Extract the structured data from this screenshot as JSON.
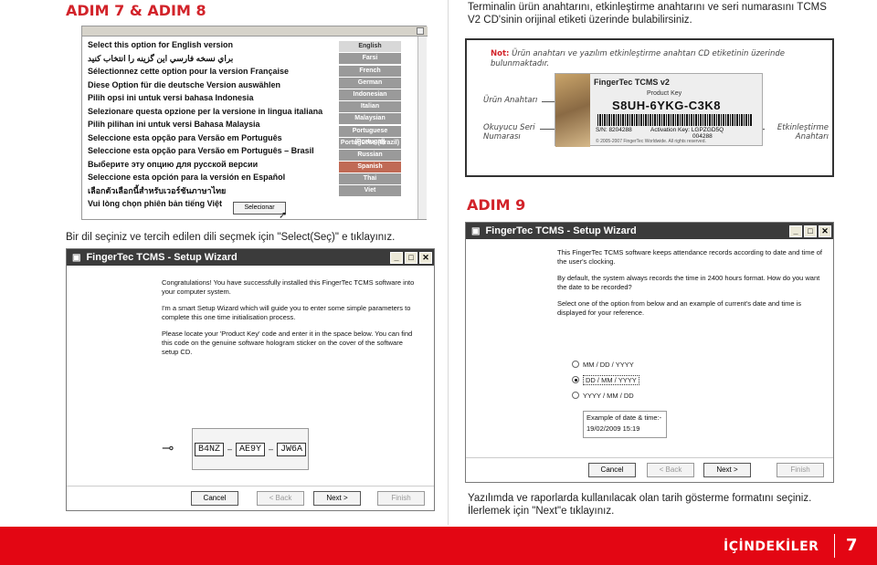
{
  "steps": {
    "left_title": "ADIM 7 & ADIM 8",
    "right_title": "ADIM 9"
  },
  "intro_text": "Terminalin ürün anahtarını, etkinleştirme anahtarını ve seri numarasını TCMS V2 CD'sinin orijinal etiketi üzerinde bulabilirsiniz.",
  "note": {
    "label": "Not:",
    "text": "Ürün anahtarı ve yazılım etkinleştirme anahtarı CD etiketinin üzerinde bulunmaktadır.",
    "callouts": {
      "product_key": "Ürün Anahtarı",
      "serial": "Okuyucu Seri Numarası",
      "activation": "Etkinleştirme Anahtarı"
    },
    "sticker": {
      "brand": "FingerTec TCMS v2",
      "pk_label": "Product Key",
      "pk_value": "S8UH-6YKG-C3K8",
      "sn": "S/N: 8204288",
      "activation": "Activation Key: LGPZGD5Q",
      "small": "004288",
      "copyright": "© 2005-2007 FingerTec Worldwide. All rights reserved."
    }
  },
  "language_window": {
    "rows": [
      "Select this option for English version",
      "براي نسخه فارسي اين گزينه را انتخاب كنيد",
      "Sélectionnez cette option pour la version Française",
      "Diese Option für die deutsche Version auswählen",
      "Pilih opsi ini untuk versi bahasa Indonesia",
      "Selezionare questa opzione per la versione in lingua italiana",
      "Pilih pilihan ini untuk versi Bahasa Malaysia",
      "Seleccione esta opção para Versão em Português",
      "Seleccione esta opção para Versão em Português – Brasil",
      "Выберите эту опцию для русской версии",
      "Seleccione esta opción para la versión en Español",
      "เลือกตัวเลือกนี้สำหรับเวอร์ชันภาษาไทย",
      "Vui lòng chọn phiên bản tiếng Việt"
    ],
    "buttons": [
      "English",
      "Farsi",
      "French",
      "German",
      "Indonesian",
      "Italian",
      "Malaysian",
      "Portuguese (Portugal)",
      "Portuguese (Brazil)",
      "Russian",
      "Spanish",
      "Thai",
      "Viet"
    ],
    "select_label": "Selecionar"
  },
  "left_caption": "Bir dil seçiniz ve tercih edilen dili seçmek için \"Select(Seç)\" e tıklayınız.",
  "wizard1": {
    "title": "FingerTec TCMS - Setup Wizard",
    "p1": "Congratulations! You have successfully installed this FingerTec TCMS software into your computer system.",
    "p2": "I'm a smart Setup Wizard which will guide you to enter some simple parameters to complete this one time initialisation process.",
    "p3": "Please locate your 'Product Key' code and enter it in the space below. You can find this code on the genuine software hologram sticker on the cover of the software setup CD.",
    "keys": [
      "B4NZ",
      "AE9Y",
      "JW6A"
    ],
    "cancel": "Cancel",
    "back": "< Back",
    "next": "Next >",
    "finish": "Finish"
  },
  "wizard2": {
    "title": "FingerTec TCMS - Setup Wizard",
    "p1": "This FingerTec TCMS software keeps attendance records according to date and time of the user's clocking.",
    "p2": "By default, the system always records the time in 2400 hours format. How do you want the date to be recorded?",
    "p3": "Select one of the option from below and an example of current's date and time is displayed for your reference.",
    "options": [
      "MM / DD / YYYY",
      "DD / MM / YYYY",
      "YYYY / MM / DD"
    ],
    "example_label": "Example of date & time:-",
    "example_value": "19/02/2009 15:19",
    "cancel": "Cancel",
    "back": "< Back",
    "next": "Next >",
    "finish": "Finish"
  },
  "right_caption": "Yazılımda ve raporlarda kullanılacak olan tarih gösterme formatını seçiniz. İlerlemek için \"Next\"e tıklayınız.",
  "footer": {
    "contents_label": "İÇİNDEKİLER",
    "page_number": "7"
  },
  "colors": {
    "accent": "#d2232a",
    "footer_bg": "#e30613"
  }
}
